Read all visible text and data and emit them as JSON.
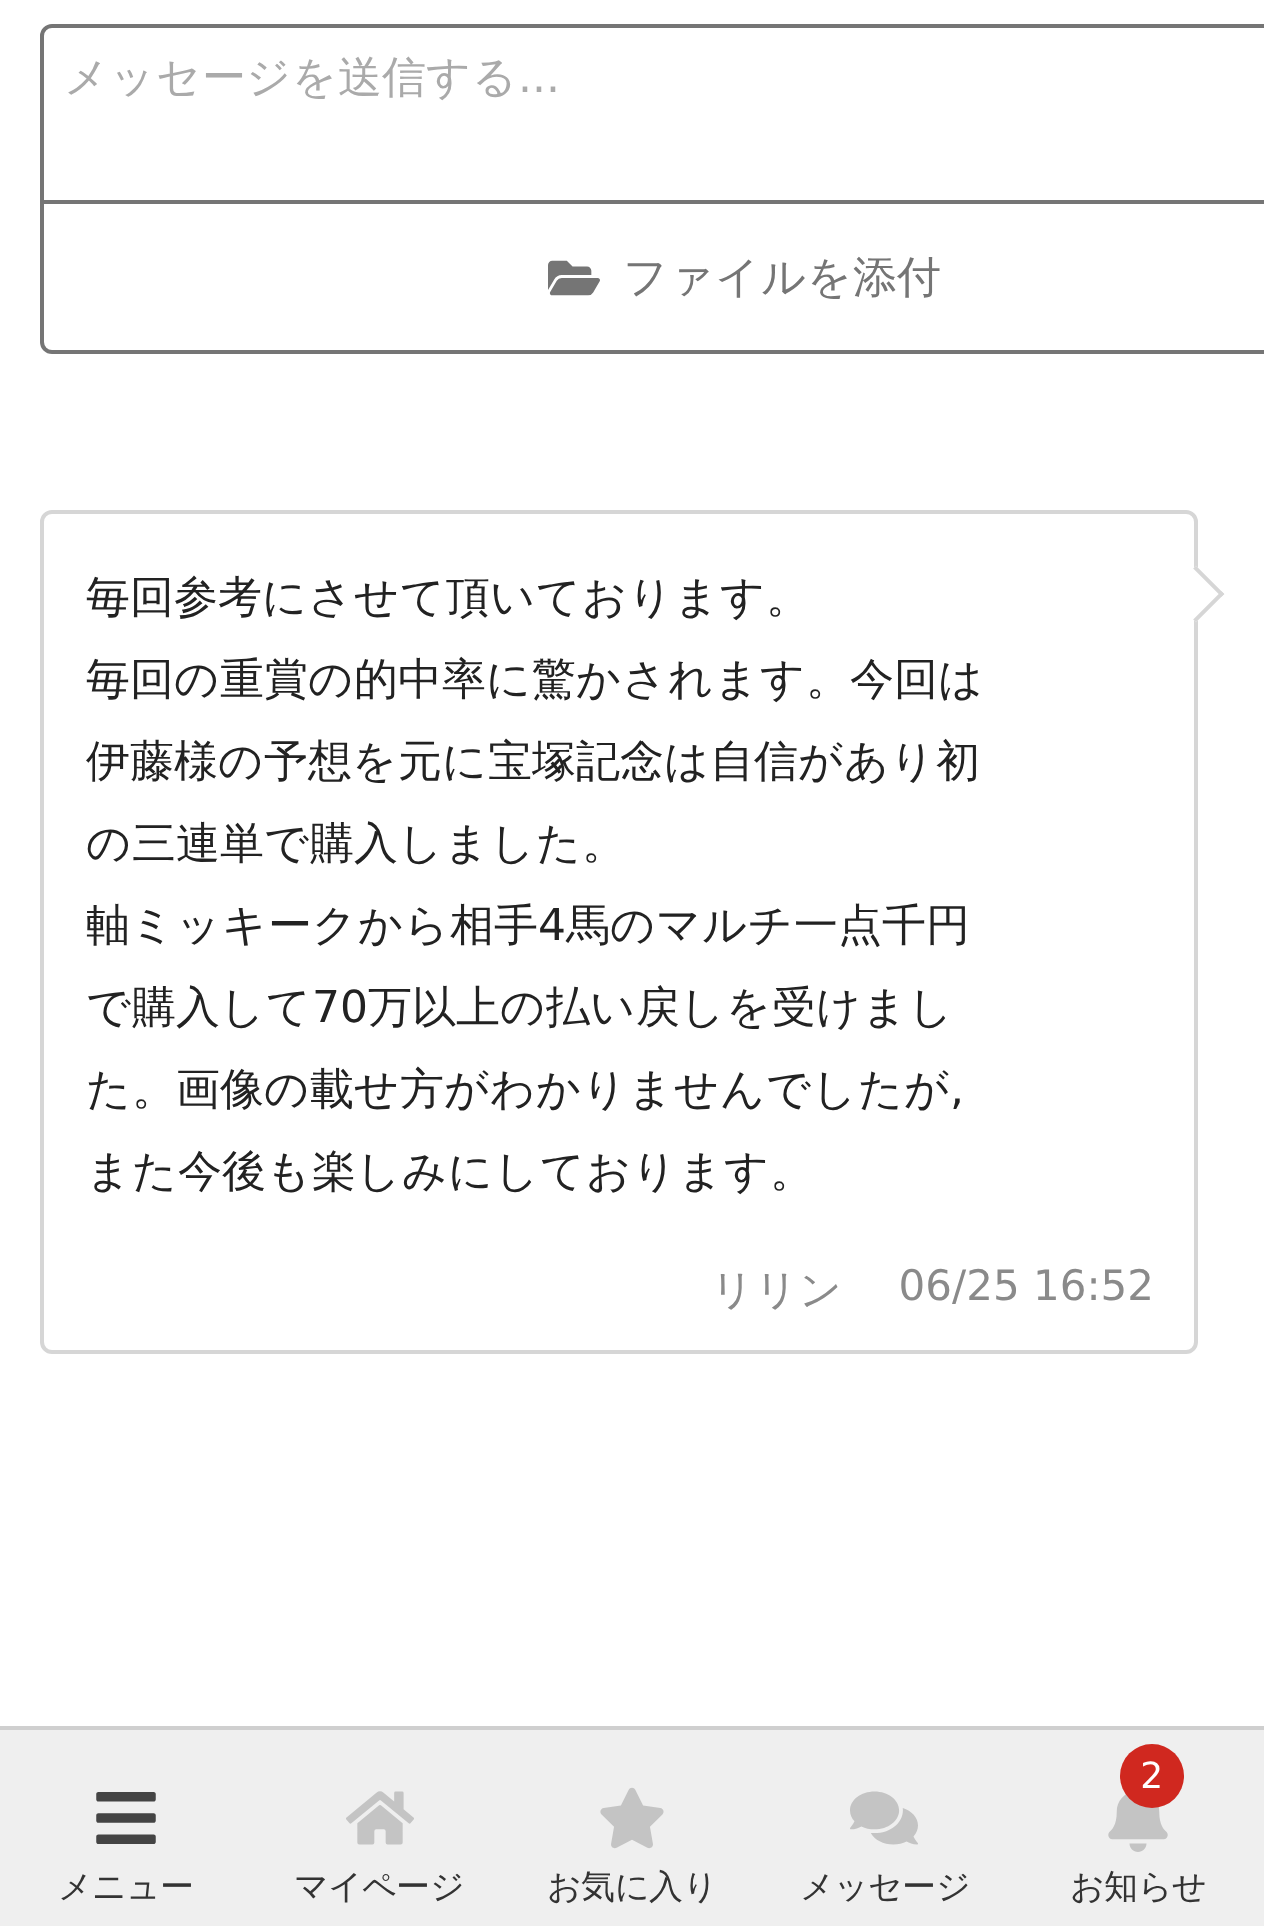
{
  "composer": {
    "placeholder": "メッセージを送信する...",
    "attach_button": "ファイルを添付"
  },
  "messages": [
    {
      "lines": [
        "毎回参考にさせて頂いております。",
        "毎回の重賞の的中率に驚かされます。今回は",
        "伊藤様の予想を元に宝塚記念は自信があり初",
        "の三連単で購入しました。",
        "軸ミッキークから相手4馬のマルチ一点千円",
        "で購入して70万以上の払い戻しを受けまし",
        "た。画像の載せ方がわかりませんでしたが,",
        "また今後も楽しみにしております。"
      ],
      "author": "リリン",
      "time": "06/25 16:52"
    }
  ],
  "bottom_nav": [
    {
      "kind": "menu",
      "label": "メニュー",
      "selected": true
    },
    {
      "kind": "home",
      "label": "マイページ",
      "selected": false
    },
    {
      "kind": "favorites",
      "label": "お気に入り",
      "selected": false
    },
    {
      "kind": "messages",
      "label": "メッセージ",
      "selected": false
    },
    {
      "kind": "notifications",
      "label": "お知らせ",
      "selected": false,
      "badge": "2"
    }
  ]
}
